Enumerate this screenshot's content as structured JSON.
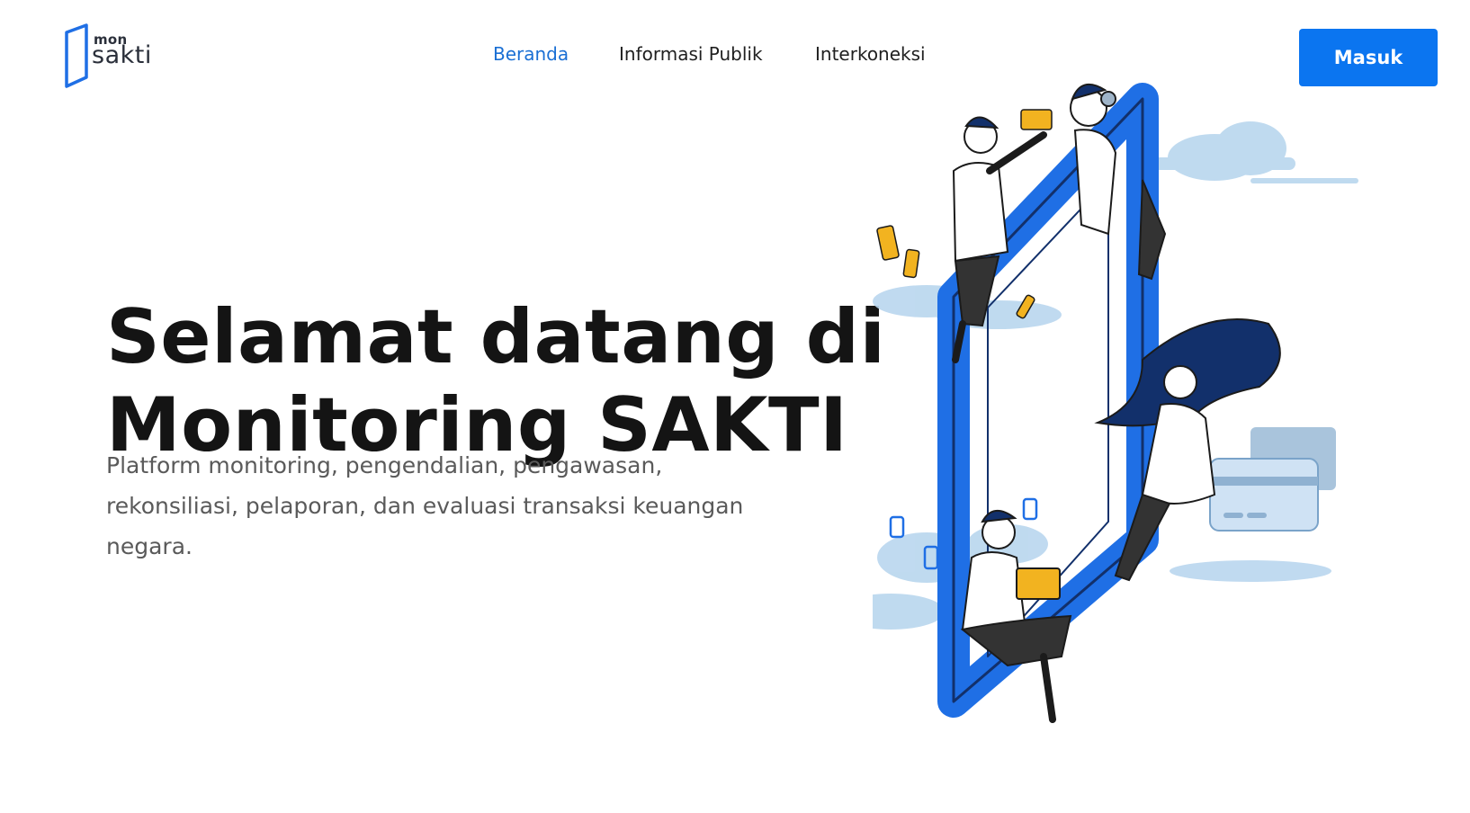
{
  "logo": {
    "mon": "mon",
    "sakti": "sakti"
  },
  "nav": {
    "items": [
      {
        "label": "Beranda",
        "active": true
      },
      {
        "label": "Informasi Publik",
        "active": false
      },
      {
        "label": "Interkoneksi",
        "active": false
      }
    ]
  },
  "header": {
    "login_label": "Masuk"
  },
  "hero": {
    "title_lines": [
      "Selamat datang di",
      "Monitoring SAKTI"
    ],
    "subtitle_lines": [
      "Platform monitoring, pengendalian, pengawasan,",
      "rekonsiliasi, pelaporan, dan evaluasi transaksi keuangan",
      "negara."
    ]
  },
  "colors": {
    "accent": "#0b75f0",
    "active_nav": "#1a6fd4",
    "title": "#141414",
    "subtitle": "#5a5a5a",
    "illustration_blue": "#1f6fe5",
    "illustration_navy": "#12306b",
    "illustration_yellow": "#f2b320",
    "cloud": "#b9d6ee"
  },
  "icons": [
    "logo-mark-icon"
  ]
}
